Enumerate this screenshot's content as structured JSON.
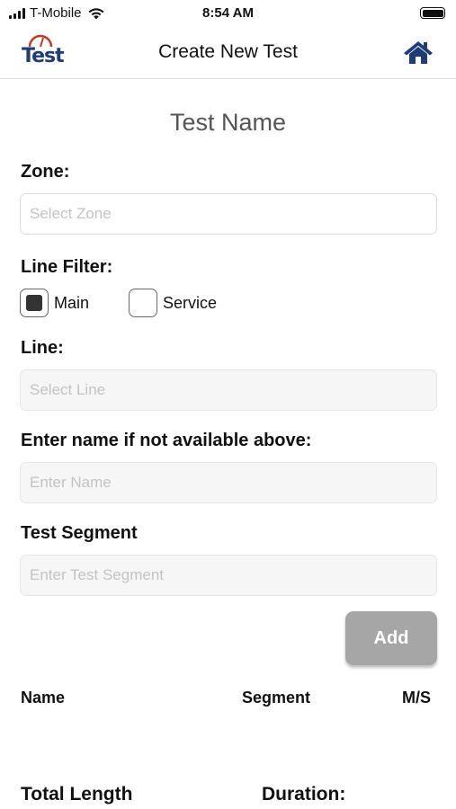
{
  "status_bar": {
    "carrier": "T-Mobile",
    "time": "8:54 AM",
    "battery_level": 1.0,
    "icons": [
      "signal-icon",
      "wifi-icon",
      "battery-icon"
    ]
  },
  "nav": {
    "logo_text": "Test",
    "title": "Create New Test",
    "home_icon": "home-icon"
  },
  "form": {
    "test_name": "Test Name",
    "zone_label": "Zone:",
    "zone_placeholder": "Select Zone",
    "line_filter_label": "Line Filter:",
    "filter_main": "Main",
    "filter_service": "Service",
    "filter_main_checked": true,
    "filter_service_checked": false,
    "line_label": "Line:",
    "line_placeholder": "Select Line",
    "name_label": "Enter name if not available above:",
    "name_placeholder": "Enter Name",
    "segment_label": "Test Segment",
    "segment_placeholder": "Enter Test Segment",
    "add_label": "Add"
  },
  "table": {
    "headers": [
      "Name",
      "Segment",
      "M/S"
    ],
    "rows": []
  },
  "footer": {
    "total_length_label": "Total Length",
    "duration_label": "Duration:"
  },
  "colors": {
    "brand_blue": "#1d3c78",
    "logo_red": "#c0392b",
    "add_button": "#a6a6a6"
  }
}
